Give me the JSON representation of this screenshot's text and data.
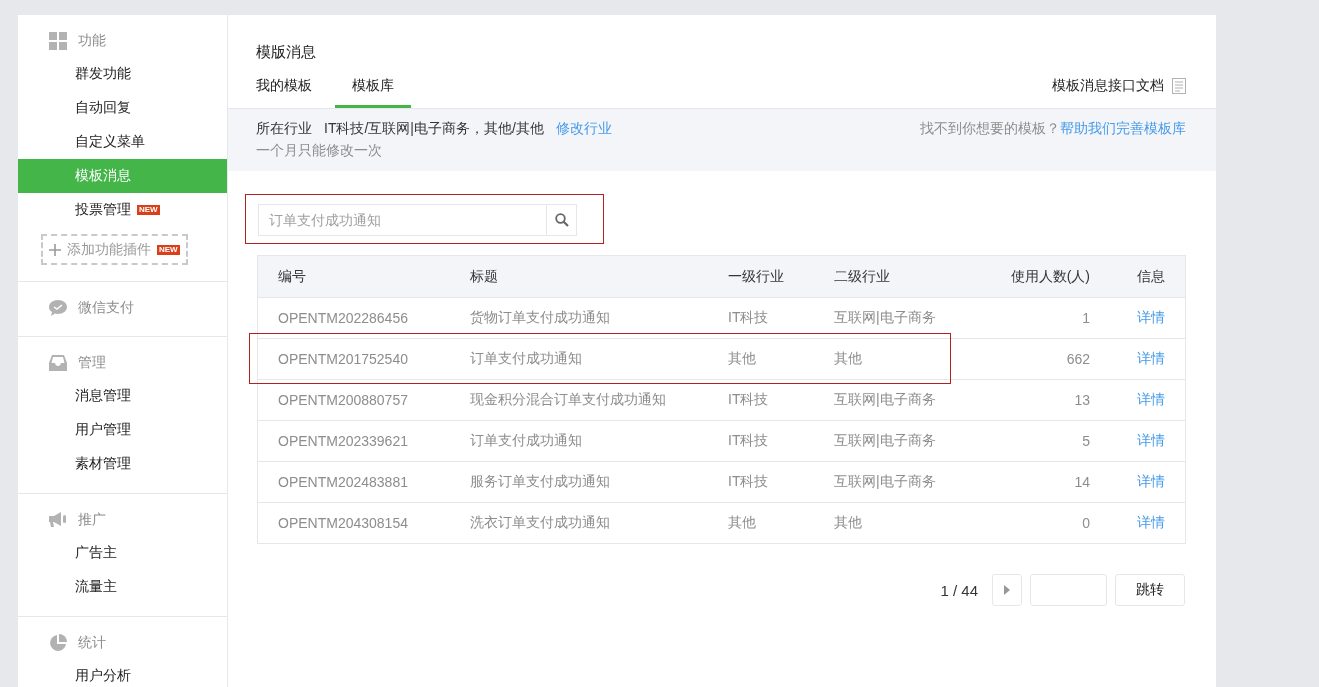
{
  "sidebar": {
    "groups": [
      {
        "kind": "grid",
        "label": "功能",
        "items": [
          {
            "label": "群发功能",
            "selected": false
          },
          {
            "label": "自动回复",
            "selected": false
          },
          {
            "label": "自定义菜单",
            "selected": false
          },
          {
            "label": "模板消息",
            "selected": true
          },
          {
            "label": "投票管理",
            "selected": false,
            "badge": "NEW"
          }
        ],
        "add_button": {
          "label": "添加功能插件",
          "badge": "NEW"
        }
      },
      {
        "kind": "chat",
        "label": "微信支付"
      },
      {
        "kind": "tray",
        "label": "管理",
        "items": [
          {
            "label": "消息管理",
            "selected": false
          },
          {
            "label": "用户管理",
            "selected": false
          },
          {
            "label": "素材管理",
            "selected": false
          }
        ]
      },
      {
        "kind": "megaphone",
        "label": "推广",
        "items": [
          {
            "label": "广告主",
            "selected": false
          },
          {
            "label": "流量主",
            "selected": false
          }
        ]
      },
      {
        "kind": "pie",
        "label": "统计",
        "items": [
          {
            "label": "用户分析",
            "selected": false
          }
        ]
      }
    ]
  },
  "page_title": "模版消息",
  "tabs": [
    {
      "label": "我的模板",
      "selected": false
    },
    {
      "label": "模板库",
      "selected": true
    }
  ],
  "doc_link": "模板消息接口文档",
  "industry": {
    "label": "所在行业",
    "value": "IT科技/互联网|电子商务，其他/其他",
    "action": "修改行业",
    "note": "一个月只能修改一次",
    "help_text": "找不到你想要的模板？",
    "help_link": "帮助我们完善模板库"
  },
  "search": {
    "placeholder": "订单支付成功通知",
    "highlighted": true
  },
  "table": {
    "columns": [
      "编号",
      "标题",
      "一级行业",
      "二级行业",
      "使用人数(人)",
      "信息"
    ],
    "rows": [
      {
        "cells": [
          "OPENTM202286456",
          "货物订单支付成功通知",
          "IT科技",
          "互联网|电子商务",
          "1"
        ],
        "link": "详情",
        "highlighted": false
      },
      {
        "cells": [
          "OPENTM201752540",
          "订单支付成功通知",
          "其他",
          "其他",
          "662"
        ],
        "link": "详情",
        "highlighted": true
      },
      {
        "cells": [
          "OPENTM200880757",
          "现金积分混合订单支付成功通知",
          "IT科技",
          "互联网|电子商务",
          "13"
        ],
        "link": "详情",
        "highlighted": false
      },
      {
        "cells": [
          "OPENTM202339621",
          "订单支付成功通知",
          "IT科技",
          "互联网|电子商务",
          "5"
        ],
        "link": "详情",
        "highlighted": false
      },
      {
        "cells": [
          "OPENTM202483881",
          "服务订单支付成功通知",
          "IT科技",
          "互联网|电子商务",
          "14"
        ],
        "link": "详情",
        "highlighted": false
      },
      {
        "cells": [
          "OPENTM204308154",
          "洗衣订单支付成功通知",
          "其他",
          "其他",
          "0"
        ],
        "link": "详情",
        "highlighted": false
      }
    ]
  },
  "pagination": {
    "page": "1 / 44",
    "jump": "跳转"
  }
}
